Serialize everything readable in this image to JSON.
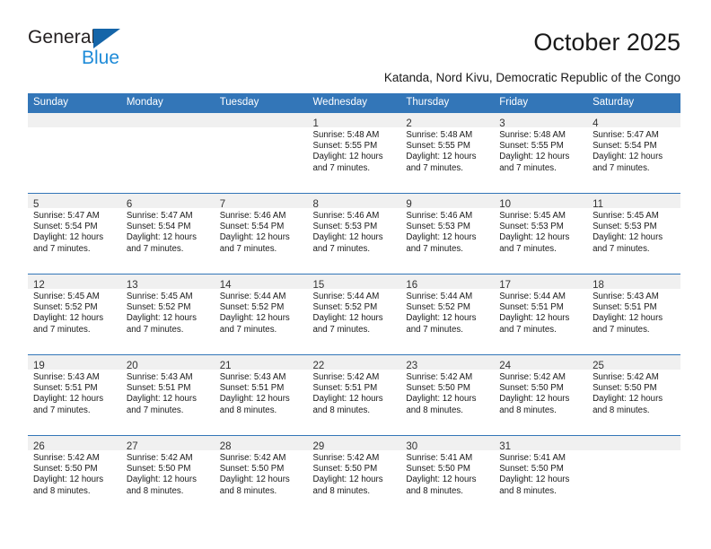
{
  "brand": {
    "name_top": "General",
    "name_bottom": "Blue",
    "triangle_color": "#1565a8",
    "blue_color": "#1e8bd8"
  },
  "header": {
    "title": "October 2025",
    "subtitle": "Katanda, Nord Kivu, Democratic Republic of the Congo"
  },
  "theme": {
    "header_bg": "#3376b8",
    "daynum_bg": "#f0f0f0",
    "row_border": "#3376b8"
  },
  "weekday_headers": [
    "Sunday",
    "Monday",
    "Tuesday",
    "Wednesday",
    "Thursday",
    "Friday",
    "Saturday"
  ],
  "weeks": [
    [
      {
        "day": "",
        "sunrise": "",
        "sunset": "",
        "daylight": "",
        "empty": true
      },
      {
        "day": "",
        "sunrise": "",
        "sunset": "",
        "daylight": "",
        "empty": true
      },
      {
        "day": "",
        "sunrise": "",
        "sunset": "",
        "daylight": "",
        "empty": true
      },
      {
        "day": "1",
        "sunrise": "Sunrise: 5:48 AM",
        "sunset": "Sunset: 5:55 PM",
        "daylight": "Daylight: 12 hours and 7 minutes."
      },
      {
        "day": "2",
        "sunrise": "Sunrise: 5:48 AM",
        "sunset": "Sunset: 5:55 PM",
        "daylight": "Daylight: 12 hours and 7 minutes."
      },
      {
        "day": "3",
        "sunrise": "Sunrise: 5:48 AM",
        "sunset": "Sunset: 5:55 PM",
        "daylight": "Daylight: 12 hours and 7 minutes."
      },
      {
        "day": "4",
        "sunrise": "Sunrise: 5:47 AM",
        "sunset": "Sunset: 5:54 PM",
        "daylight": "Daylight: 12 hours and 7 minutes."
      }
    ],
    [
      {
        "day": "5",
        "sunrise": "Sunrise: 5:47 AM",
        "sunset": "Sunset: 5:54 PM",
        "daylight": "Daylight: 12 hours and 7 minutes."
      },
      {
        "day": "6",
        "sunrise": "Sunrise: 5:47 AM",
        "sunset": "Sunset: 5:54 PM",
        "daylight": "Daylight: 12 hours and 7 minutes."
      },
      {
        "day": "7",
        "sunrise": "Sunrise: 5:46 AM",
        "sunset": "Sunset: 5:54 PM",
        "daylight": "Daylight: 12 hours and 7 minutes."
      },
      {
        "day": "8",
        "sunrise": "Sunrise: 5:46 AM",
        "sunset": "Sunset: 5:53 PM",
        "daylight": "Daylight: 12 hours and 7 minutes."
      },
      {
        "day": "9",
        "sunrise": "Sunrise: 5:46 AM",
        "sunset": "Sunset: 5:53 PM",
        "daylight": "Daylight: 12 hours and 7 minutes."
      },
      {
        "day": "10",
        "sunrise": "Sunrise: 5:45 AM",
        "sunset": "Sunset: 5:53 PM",
        "daylight": "Daylight: 12 hours and 7 minutes."
      },
      {
        "day": "11",
        "sunrise": "Sunrise: 5:45 AM",
        "sunset": "Sunset: 5:53 PM",
        "daylight": "Daylight: 12 hours and 7 minutes."
      }
    ],
    [
      {
        "day": "12",
        "sunrise": "Sunrise: 5:45 AM",
        "sunset": "Sunset: 5:52 PM",
        "daylight": "Daylight: 12 hours and 7 minutes."
      },
      {
        "day": "13",
        "sunrise": "Sunrise: 5:45 AM",
        "sunset": "Sunset: 5:52 PM",
        "daylight": "Daylight: 12 hours and 7 minutes."
      },
      {
        "day": "14",
        "sunrise": "Sunrise: 5:44 AM",
        "sunset": "Sunset: 5:52 PM",
        "daylight": "Daylight: 12 hours and 7 minutes."
      },
      {
        "day": "15",
        "sunrise": "Sunrise: 5:44 AM",
        "sunset": "Sunset: 5:52 PM",
        "daylight": "Daylight: 12 hours and 7 minutes."
      },
      {
        "day": "16",
        "sunrise": "Sunrise: 5:44 AM",
        "sunset": "Sunset: 5:52 PM",
        "daylight": "Daylight: 12 hours and 7 minutes."
      },
      {
        "day": "17",
        "sunrise": "Sunrise: 5:44 AM",
        "sunset": "Sunset: 5:51 PM",
        "daylight": "Daylight: 12 hours and 7 minutes."
      },
      {
        "day": "18",
        "sunrise": "Sunrise: 5:43 AM",
        "sunset": "Sunset: 5:51 PM",
        "daylight": "Daylight: 12 hours and 7 minutes."
      }
    ],
    [
      {
        "day": "19",
        "sunrise": "Sunrise: 5:43 AM",
        "sunset": "Sunset: 5:51 PM",
        "daylight": "Daylight: 12 hours and 7 minutes."
      },
      {
        "day": "20",
        "sunrise": "Sunrise: 5:43 AM",
        "sunset": "Sunset: 5:51 PM",
        "daylight": "Daylight: 12 hours and 7 minutes."
      },
      {
        "day": "21",
        "sunrise": "Sunrise: 5:43 AM",
        "sunset": "Sunset: 5:51 PM",
        "daylight": "Daylight: 12 hours and 8 minutes."
      },
      {
        "day": "22",
        "sunrise": "Sunrise: 5:42 AM",
        "sunset": "Sunset: 5:51 PM",
        "daylight": "Daylight: 12 hours and 8 minutes."
      },
      {
        "day": "23",
        "sunrise": "Sunrise: 5:42 AM",
        "sunset": "Sunset: 5:50 PM",
        "daylight": "Daylight: 12 hours and 8 minutes."
      },
      {
        "day": "24",
        "sunrise": "Sunrise: 5:42 AM",
        "sunset": "Sunset: 5:50 PM",
        "daylight": "Daylight: 12 hours and 8 minutes."
      },
      {
        "day": "25",
        "sunrise": "Sunrise: 5:42 AM",
        "sunset": "Sunset: 5:50 PM",
        "daylight": "Daylight: 12 hours and 8 minutes."
      }
    ],
    [
      {
        "day": "26",
        "sunrise": "Sunrise: 5:42 AM",
        "sunset": "Sunset: 5:50 PM",
        "daylight": "Daylight: 12 hours and 8 minutes."
      },
      {
        "day": "27",
        "sunrise": "Sunrise: 5:42 AM",
        "sunset": "Sunset: 5:50 PM",
        "daylight": "Daylight: 12 hours and 8 minutes."
      },
      {
        "day": "28",
        "sunrise": "Sunrise: 5:42 AM",
        "sunset": "Sunset: 5:50 PM",
        "daylight": "Daylight: 12 hours and 8 minutes."
      },
      {
        "day": "29",
        "sunrise": "Sunrise: 5:42 AM",
        "sunset": "Sunset: 5:50 PM",
        "daylight": "Daylight: 12 hours and 8 minutes."
      },
      {
        "day": "30",
        "sunrise": "Sunrise: 5:41 AM",
        "sunset": "Sunset: 5:50 PM",
        "daylight": "Daylight: 12 hours and 8 minutes."
      },
      {
        "day": "31",
        "sunrise": "Sunrise: 5:41 AM",
        "sunset": "Sunset: 5:50 PM",
        "daylight": "Daylight: 12 hours and 8 minutes."
      },
      {
        "day": "",
        "sunrise": "",
        "sunset": "",
        "daylight": "",
        "empty": true
      }
    ]
  ]
}
